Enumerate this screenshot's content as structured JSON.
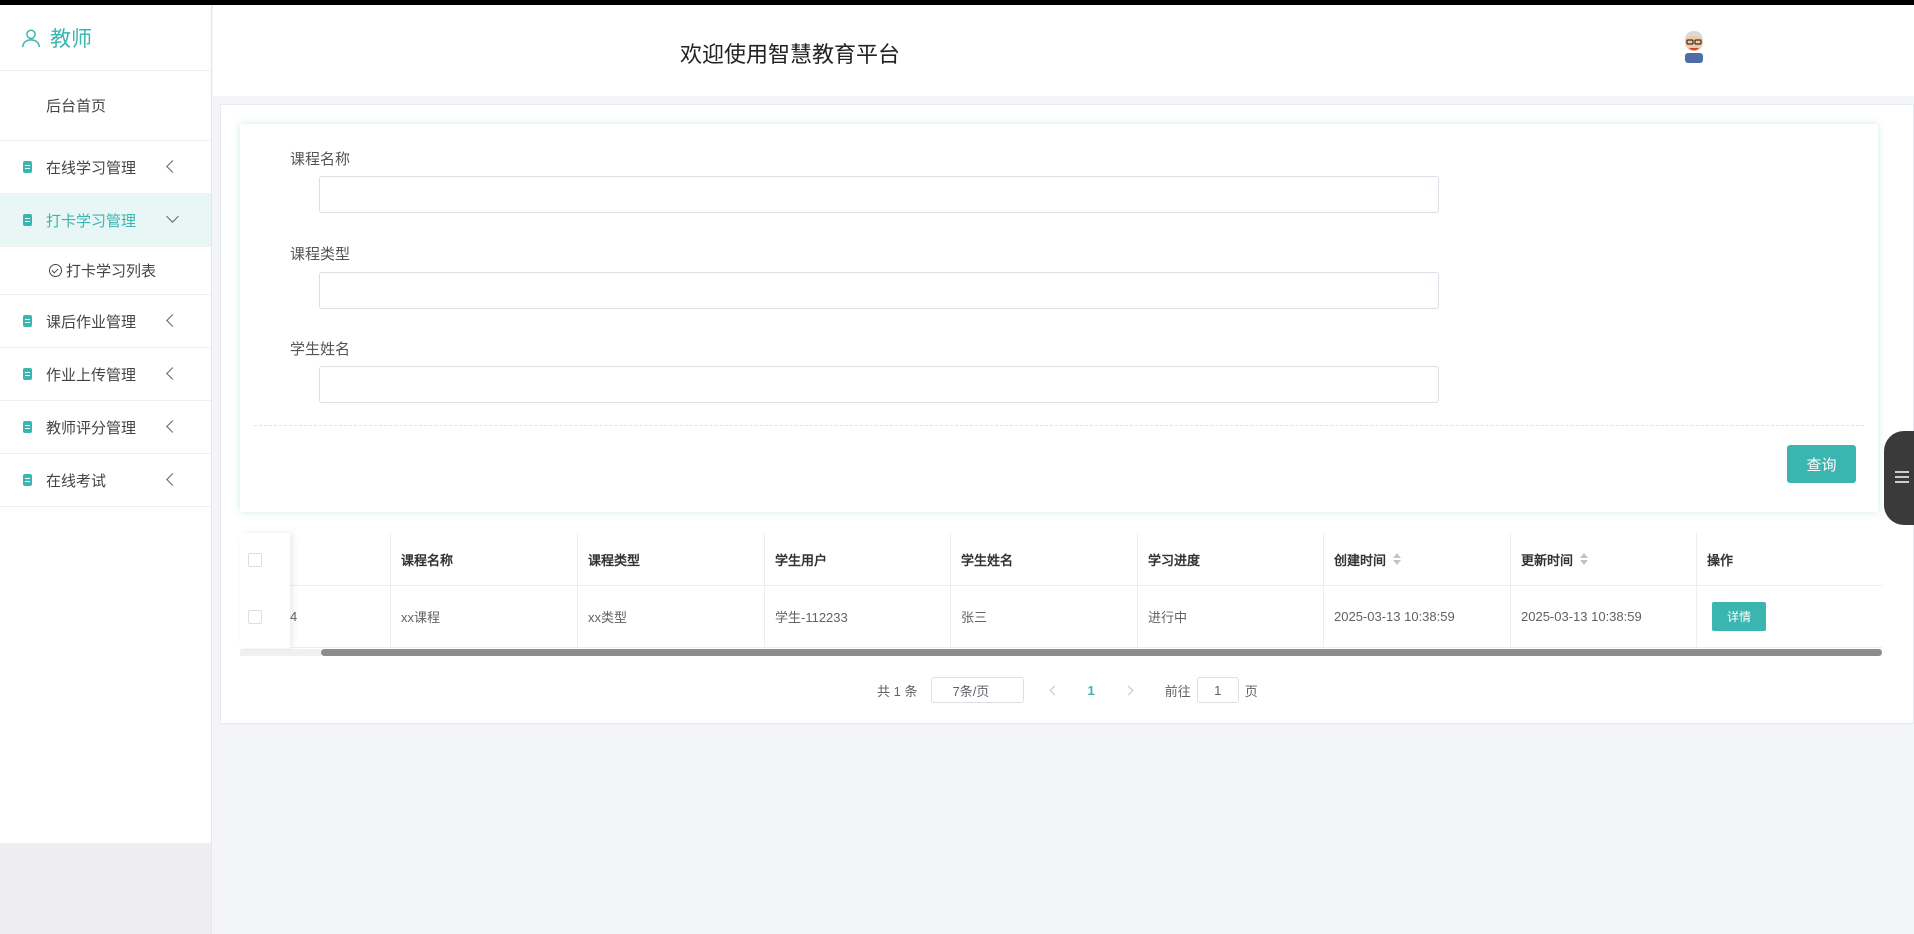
{
  "sidebar": {
    "role_title": "教师",
    "home": "后台首页",
    "items": [
      {
        "label": "在线学习管理"
      },
      {
        "label": "打卡学习管理"
      },
      {
        "label": "课后作业管理"
      },
      {
        "label": "作业上传管理"
      },
      {
        "label": "教师评分管理"
      },
      {
        "label": "在线考试"
      }
    ],
    "submenu": {
      "label": "打卡学习列表"
    }
  },
  "header": {
    "title": "欢迎使用智慧教育平台"
  },
  "search": {
    "course_name_label": "课程名称",
    "course_type_label": "课程类型",
    "student_name_label": "学生姓名",
    "course_name_value": "",
    "course_type_value": "",
    "student_name_value": "",
    "query_label": "查询"
  },
  "table": {
    "first_col_fragment": "4",
    "headers": [
      "课程名称",
      "课程类型",
      "学生用户",
      "学生姓名",
      "学习进度",
      "创建时间",
      "更新时间",
      "操作"
    ],
    "rows": [
      {
        "course_name": "xx课程",
        "course_type": "xx类型",
        "student_user": "学生-112233",
        "student_name": "张三",
        "progress": "进行中",
        "created": "2025-03-13 10:38:59",
        "updated": "2025-03-13 10:38:59",
        "action": "详情"
      }
    ]
  },
  "pagination": {
    "total": "共 1 条",
    "page_size": "7条/页",
    "current_page": "1",
    "goto_prefix": "前往",
    "goto_value": "1",
    "goto_suffix": "页"
  },
  "colors": {
    "accent": "#3ab5b0"
  }
}
